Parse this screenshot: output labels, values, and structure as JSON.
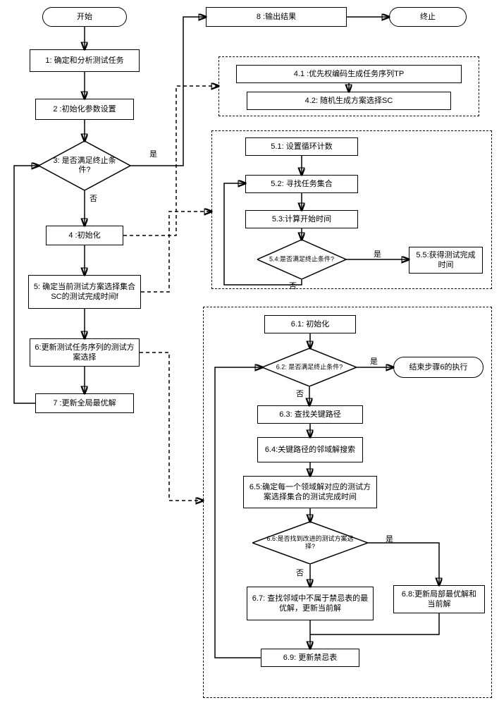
{
  "terminators": {
    "start": "开始",
    "end": "终止"
  },
  "main_steps": {
    "s1": "1: 确定和分析测试任务",
    "s2": "2 :初始化参数设置",
    "s3": "3: 是否满足终止条件?",
    "s4": "4 :初始化",
    "s5": "5: 确定当前测试方案选择集合SC的测试完成时间f",
    "s6": "6:更新测试任务序列的测试方案选择",
    "s7": "7 :更新全局最优解",
    "s8": "8 :输出结果"
  },
  "labels": {
    "yes": "是",
    "no": "否"
  },
  "sub4": {
    "s41": "4.1 :优先权编码生成任务序列TP",
    "s42": "4.2: 随机生成方案选择SC"
  },
  "sub5": {
    "s51": "5.1: 设置循环计数",
    "s52": "5.2: 寻找任务集合",
    "s53": "5.3:计算开始时间",
    "s54": "5.4:是否满足终止条件?",
    "s55": "5.5:获得测试完成时间"
  },
  "sub6": {
    "s61": "6.1: 初始化",
    "s62": "6.2: 是否满足终止条件?",
    "s62_exit": "结束步骤6的执行",
    "s63": "6.3: 查找关键路径",
    "s64": "6.4:关键路径的邻域解搜索",
    "s65": "6.5:确定每一个领域解对应的测试方案选择集合的测试完成时间",
    "s66": "6.6:是否找到改进的测试方案选择?",
    "s67": "6.7: 查找邻域中不属于禁忌表的最优解，更新当前解",
    "s68": "6.8:更新局部最优解和当前解",
    "s69": "6.9: 更新禁忌表"
  },
  "chart_data": {
    "type": "flowchart",
    "title": "测试任务调度算法流程图",
    "nodes": [
      {
        "id": "start",
        "type": "terminator",
        "label": "开始"
      },
      {
        "id": "1",
        "type": "process",
        "label": "确定和分析测试任务"
      },
      {
        "id": "2",
        "type": "process",
        "label": "初始化参数设置"
      },
      {
        "id": "3",
        "type": "decision",
        "label": "是否满足终止条件?"
      },
      {
        "id": "4",
        "type": "process",
        "label": "初始化",
        "sub": [
          "4.1",
          "4.2"
        ]
      },
      {
        "id": "4.1",
        "type": "process",
        "label": "优先权编码生成任务序列TP"
      },
      {
        "id": "4.2",
        "type": "process",
        "label": "随机生成方案选择SC"
      },
      {
        "id": "5",
        "type": "process",
        "label": "确定当前测试方案选择集合SC的测试完成时间f",
        "sub": [
          "5.1",
          "5.2",
          "5.3",
          "5.4",
          "5.5"
        ]
      },
      {
        "id": "5.1",
        "type": "process",
        "label": "设置循环计数"
      },
      {
        "id": "5.2",
        "type": "process",
        "label": "寻找任务集合"
      },
      {
        "id": "5.3",
        "type": "process",
        "label": "计算开始时间"
      },
      {
        "id": "5.4",
        "type": "decision",
        "label": "是否满足终止条件?"
      },
      {
        "id": "5.5",
        "type": "process",
        "label": "获得测试完成时间"
      },
      {
        "id": "6",
        "type": "process",
        "label": "更新测试任务序列的测试方案选择",
        "sub": [
          "6.1",
          "6.2",
          "6.3",
          "6.4",
          "6.5",
          "6.6",
          "6.7",
          "6.8",
          "6.9"
        ]
      },
      {
        "id": "6.1",
        "type": "process",
        "label": "初始化"
      },
      {
        "id": "6.2",
        "type": "decision",
        "label": "是否满足终止条件?"
      },
      {
        "id": "6.2exit",
        "type": "terminator",
        "label": "结束步骤6的执行"
      },
      {
        "id": "6.3",
        "type": "process",
        "label": "查找关键路径"
      },
      {
        "id": "6.4",
        "type": "process",
        "label": "关键路径的邻域解搜索"
      },
      {
        "id": "6.5",
        "type": "process",
        "label": "确定每一个领域解对应的测试方案选择集合的测试完成时间"
      },
      {
        "id": "6.6",
        "type": "decision",
        "label": "是否找到改进的测试方案选择?"
      },
      {
        "id": "6.7",
        "type": "process",
        "label": "查找邻域中不属于禁忌表的最优解，更新当前解"
      },
      {
        "id": "6.8",
        "type": "process",
        "label": "更新局部最优解和当前解"
      },
      {
        "id": "6.9",
        "type": "process",
        "label": "更新禁忌表"
      },
      {
        "id": "7",
        "type": "process",
        "label": "更新全局最优解"
      },
      {
        "id": "8",
        "type": "process",
        "label": "输出结果"
      },
      {
        "id": "end",
        "type": "terminator",
        "label": "终止"
      }
    ],
    "edges": [
      {
        "from": "start",
        "to": "1"
      },
      {
        "from": "1",
        "to": "2"
      },
      {
        "from": "2",
        "to": "3"
      },
      {
        "from": "3",
        "to": "4",
        "label": "否"
      },
      {
        "from": "3",
        "to": "8",
        "label": "是"
      },
      {
        "from": "4",
        "to": "5"
      },
      {
        "from": "5",
        "to": "6"
      },
      {
        "from": "6",
        "to": "7"
      },
      {
        "from": "7",
        "to": "3",
        "label": "loop"
      },
      {
        "from": "8",
        "to": "end"
      },
      {
        "from": "4",
        "to": "4.1",
        "kind": "expand",
        "style": "dashed"
      },
      {
        "from": "4.1",
        "to": "4.2"
      },
      {
        "from": "5",
        "to": "5.1",
        "kind": "expand",
        "style": "dashed"
      },
      {
        "from": "5.1",
        "to": "5.2"
      },
      {
        "from": "5.2",
        "to": "5.3"
      },
      {
        "from": "5.3",
        "to": "5.4"
      },
      {
        "from": "5.4",
        "to": "5.5",
        "label": "是"
      },
      {
        "from": "5.4",
        "to": "5.2",
        "label": "否",
        "kind": "loop"
      },
      {
        "from": "6",
        "to": "6.1",
        "kind": "expand",
        "style": "dashed"
      },
      {
        "from": "6.1",
        "to": "6.2"
      },
      {
        "from": "6.2",
        "to": "6.2exit",
        "label": "是"
      },
      {
        "from": "6.2",
        "to": "6.3",
        "label": "否"
      },
      {
        "from": "6.3",
        "to": "6.4"
      },
      {
        "from": "6.4",
        "to": "6.5"
      },
      {
        "from": "6.5",
        "to": "6.6"
      },
      {
        "from": "6.6",
        "to": "6.7",
        "label": "否"
      },
      {
        "from": "6.6",
        "to": "6.8",
        "label": "是"
      },
      {
        "from": "6.7",
        "to": "6.9"
      },
      {
        "from": "6.8",
        "to": "6.9"
      },
      {
        "from": "6.9",
        "to": "6.2",
        "kind": "loop"
      }
    ]
  }
}
